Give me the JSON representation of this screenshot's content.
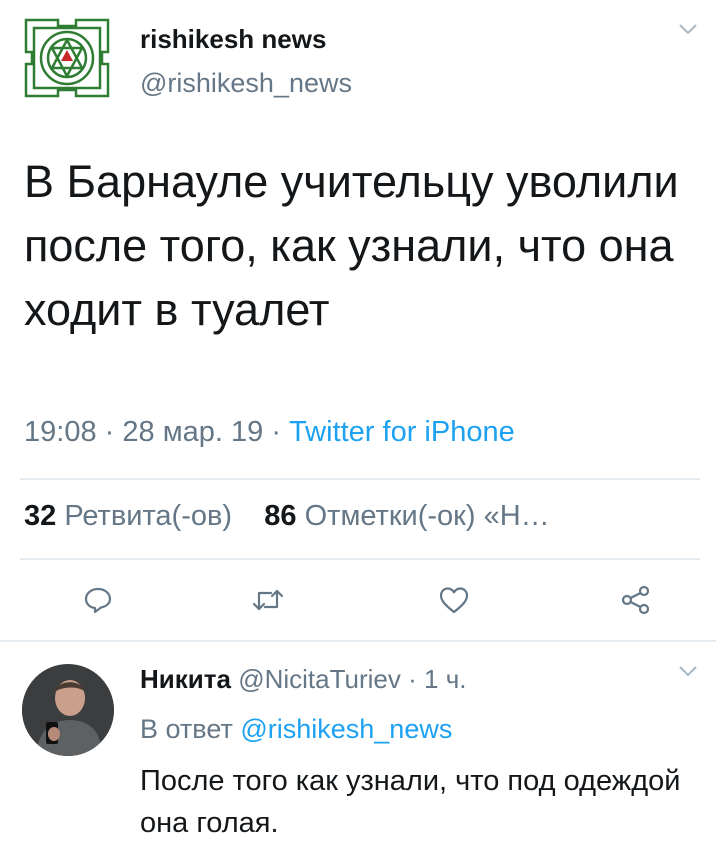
{
  "tweet": {
    "author_name": "rishikesh news",
    "author_handle": "@rishikesh_news",
    "text": "В Барнауле учительцу уволили после того, как узнали, что она ходит в туалет",
    "time": "19:08",
    "date": "28 мар. 19",
    "separator": "·",
    "source": "Twitter for iPhone",
    "retweets_count": "32",
    "retweets_label": "Ретвита(-ов)",
    "likes_count": "86",
    "likes_label": "Отметки(-ок) «Н…"
  },
  "actions": {
    "reply_icon": "reply-icon",
    "retweet_icon": "retweet-icon",
    "like_icon": "heart-icon",
    "share_icon": "share-icon"
  },
  "reply": {
    "author_name": "Никита",
    "author_handle": "@NicitaTuriev",
    "separator": "·",
    "time_ago": "1 ч.",
    "reply_to_label": "В ответ",
    "reply_to_handle": "@rishikesh_news",
    "text": "После того как узнали, что под одеждой она голая."
  },
  "colors": {
    "accent": "#1da1f2",
    "secondary_text": "#657786",
    "avatar_logo": "#2e7d32"
  }
}
